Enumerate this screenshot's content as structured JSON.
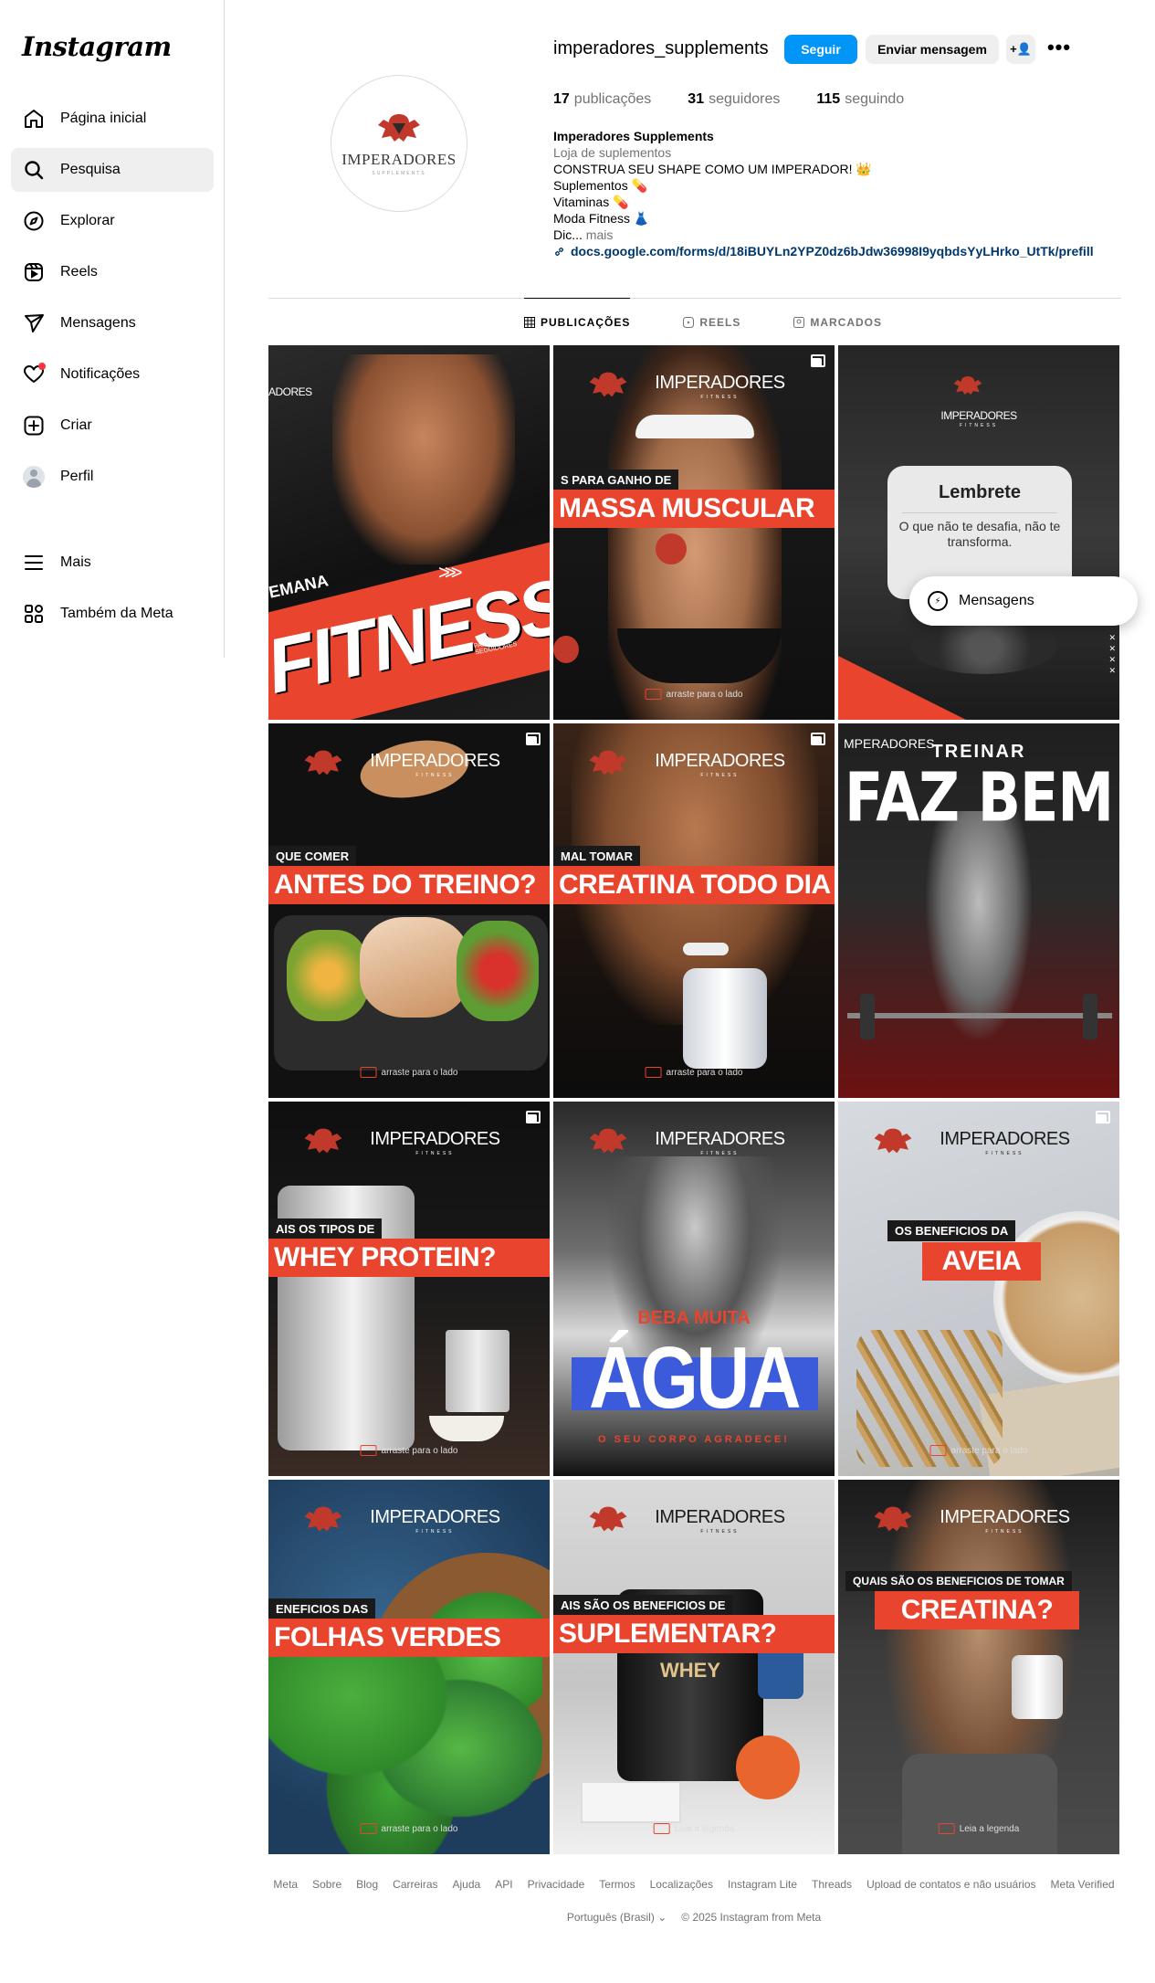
{
  "sidebar": {
    "logo": "Instagram",
    "items": [
      {
        "label": "Página inicial",
        "icon": "home-icon"
      },
      {
        "label": "Pesquisa",
        "icon": "search-icon"
      },
      {
        "label": "Explorar",
        "icon": "compass-icon"
      },
      {
        "label": "Reels",
        "icon": "reels-icon"
      },
      {
        "label": "Mensagens",
        "icon": "send-icon"
      },
      {
        "label": "Notificações",
        "icon": "heart-icon"
      },
      {
        "label": "Criar",
        "icon": "plus-square-icon"
      },
      {
        "label": "Perfil",
        "icon": "avatar-icon"
      }
    ],
    "bottom": [
      {
        "label": "Mais",
        "icon": "menu-icon"
      },
      {
        "label": "Também da Meta",
        "icon": "meta-grid-icon"
      }
    ]
  },
  "profile": {
    "username": "imperadores_supplements",
    "follow_label": "Seguir",
    "message_label": "Enviar mensagem",
    "add_label": "+👤",
    "more_label": "•••",
    "avatar_text": "IMPERADORES",
    "avatar_sub": "SUPPLEMENTS",
    "stats": {
      "posts_count": "17",
      "posts_label": "publicações",
      "followers_count": "31",
      "followers_label": "seguidores",
      "following_count": "115",
      "following_label": "seguindo"
    },
    "bio": {
      "name": "Imperadores Supplements",
      "category": "Loja de suplementos",
      "line1": "CONSTRUA SEU SHAPE COMO UM IMPERADOR! 👑",
      "line2": "Suplementos 💊",
      "line3": "Vitaminas 💊",
      "line4": "Moda Fitness 👗",
      "line5": "Dic...",
      "more": "mais",
      "link": "docs.google.com/forms/d/18iBUYLn2YPZ0dz6bJdw36998I9yqbdsYyLHrko_UtTk/prefill"
    }
  },
  "tabs": [
    {
      "label": "PUBLICAÇÕES",
      "icon": "grid-icon",
      "active": true
    },
    {
      "label": "REELS",
      "icon": "reels-icon",
      "active": false
    },
    {
      "label": "MARCADOS",
      "icon": "tag-icon",
      "active": false
    }
  ],
  "posts": {
    "brand": "IMPERADORES",
    "brand_sub": "FITNESS",
    "swipe": "arraste para o lado",
    "p1": {
      "kicker": "EMANA",
      "headline": "FITNESS",
      "arrows": ">>>",
      "tag": "PARA NOVOS SEGUIDORES",
      "brand": "ADORES"
    },
    "p2": {
      "kicker": "S PARA GANHO DE",
      "headline": "MASSA MUSCULAR"
    },
    "p3": {
      "card_title": "Lembrete",
      "card_text": "O que não te desafia, não te transforma."
    },
    "p4": {
      "kicker": "QUE COMER",
      "headline": "ANTES DO TREINO?"
    },
    "p5": {
      "kicker": "MAL TOMAR",
      "headline": "CREATINA TODO DIA"
    },
    "p6": {
      "brand": "MPERADORES",
      "line1": "TREINAR",
      "line2": "FAZ BEM"
    },
    "p7": {
      "kicker": "AIS OS TIPOS DE",
      "headline": "WHEY PROTEIN?"
    },
    "p8": {
      "line1": "BEBA MUITA",
      "line2": "ÁGUA",
      "line3": "O SEU CORPO AGRADECE!"
    },
    "p9": {
      "kicker": "OS BENEFICIOS DA",
      "headline": "AVEIA"
    },
    "p10": {
      "kicker": "ENEFICIOS DAS",
      "headline": "FOLHAS VERDES"
    },
    "p11": {
      "kicker": "AIS SÃO OS BENEFICIOS DE",
      "headline": "SUPLEMENTAR?",
      "jar_label": "WHEY",
      "swipe": "Leia a legenda"
    },
    "p12": {
      "kicker": "QUAIS SÃO OS BENEFICIOS DE TOMAR",
      "headline": "CREATINA?",
      "swipe": "Leia a legenda"
    }
  },
  "floating_messages": {
    "label": "Mensagens",
    "icon": "messenger-icon"
  },
  "footer": {
    "links": [
      "Meta",
      "Sobre",
      "Blog",
      "Carreiras",
      "Ajuda",
      "API",
      "Privacidade",
      "Termos",
      "Localizações",
      "Instagram Lite",
      "Threads",
      "Upload de contatos e não usuários",
      "Meta Verified"
    ],
    "language": "Português (Brasil)",
    "copyright": "© 2025 Instagram from Meta"
  },
  "colors": {
    "accent": "#0095f6",
    "brand_red": "#e8442e",
    "notification": "#ff3040",
    "link": "#00376b"
  }
}
